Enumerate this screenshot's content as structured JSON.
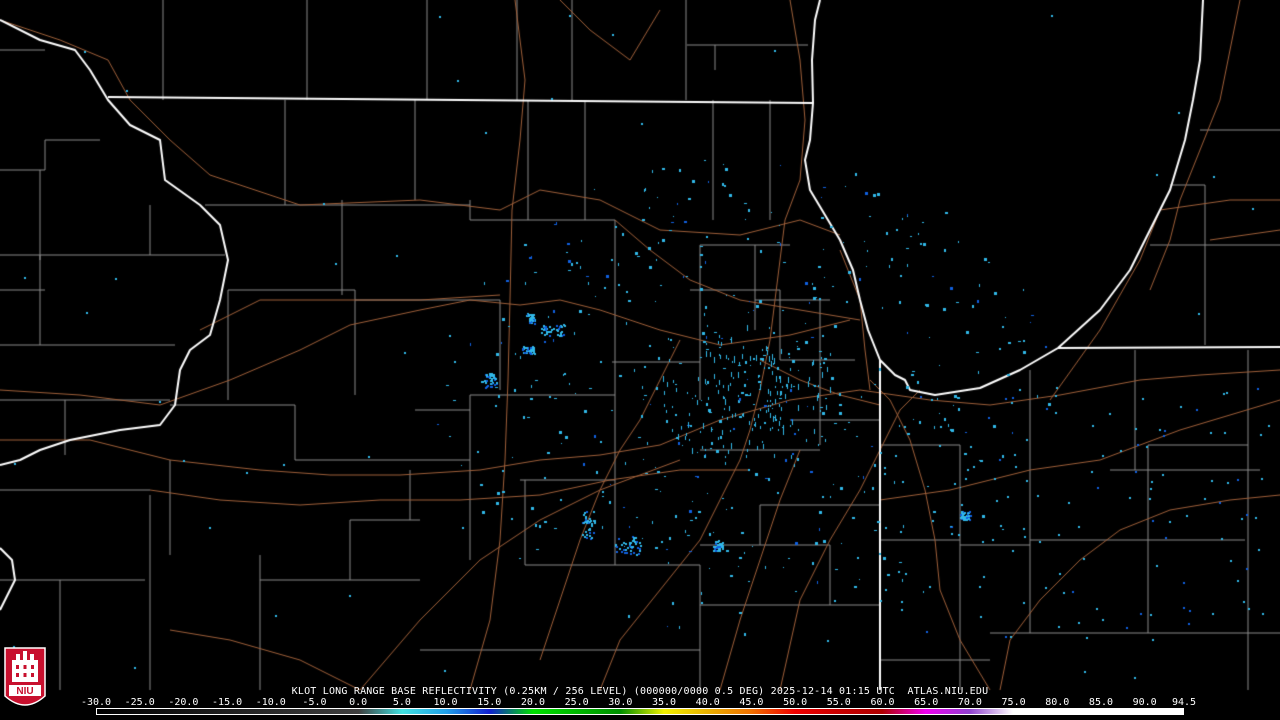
{
  "product": {
    "caption": "KLOT LONG RANGE BASE REFLECTIVITY (0.25KM / 256 LEVEL) (000000/0000 0.5 DEG) 2025-12-14 01:15 UTC  ATLAS.NIU.EDU"
  },
  "logo": {
    "text": "NIU",
    "color": "#c8102e"
  },
  "colorbar": {
    "labels": [
      "-30.0",
      "-25.0",
      "-20.0",
      "-15.0",
      "-10.0",
      "-5.0",
      "0.0",
      "5.0",
      "10.0",
      "15.0",
      "20.0",
      "25.0",
      "30.0",
      "35.0",
      "40.0",
      "45.0",
      "50.0",
      "55.0",
      "60.0",
      "65.0",
      "70.0",
      "75.0",
      "80.0",
      "85.0",
      "90.0",
      "94.5"
    ],
    "min": -30.0,
    "max": 94.5,
    "stops": [
      {
        "dbz": -30.0,
        "color": "#000000"
      },
      {
        "dbz": 0.0,
        "color": "#404040"
      },
      {
        "dbz": 5.0,
        "color": "#40e0e0"
      },
      {
        "dbz": 10.0,
        "color": "#20a0e8"
      },
      {
        "dbz": 15.0,
        "color": "#1020d0"
      },
      {
        "dbz": 20.0,
        "color": "#00e000"
      },
      {
        "dbz": 30.0,
        "color": "#009000"
      },
      {
        "dbz": 35.0,
        "color": "#f0f000"
      },
      {
        "dbz": 40.0,
        "color": "#e8b000"
      },
      {
        "dbz": 45.0,
        "color": "#f07000"
      },
      {
        "dbz": 50.0,
        "color": "#f00000"
      },
      {
        "dbz": 55.0,
        "color": "#c80000"
      },
      {
        "dbz": 60.0,
        "color": "#b00000"
      },
      {
        "dbz": 65.0,
        "color": "#f000f0"
      },
      {
        "dbz": 70.0,
        "color": "#9040d0"
      },
      {
        "dbz": 75.0,
        "color": "#ffffff"
      },
      {
        "dbz": 94.5,
        "color": "#ffffff"
      }
    ]
  },
  "map_colors": {
    "background": "#000000",
    "state_border": "#ffffff",
    "county_border": "#8a8a8a",
    "highway": "#a0603a",
    "echo_light": "#30b8e8",
    "echo_dark": "#1060e0"
  }
}
